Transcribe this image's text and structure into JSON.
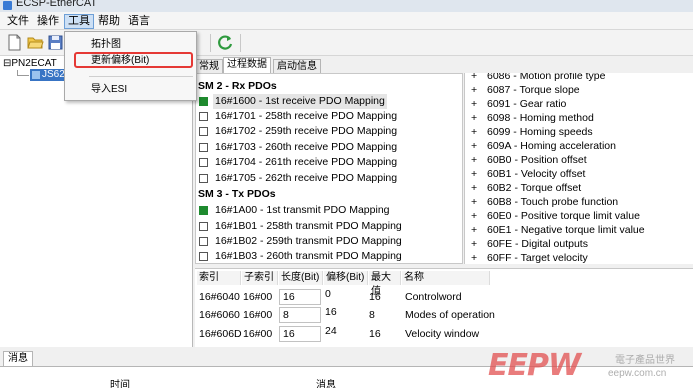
{
  "app": {
    "title": "ECSP-EtherCAT"
  },
  "menubar": {
    "items": [
      "文件",
      "操作",
      "工具",
      "帮助",
      "语言"
    ]
  },
  "tools_menu": {
    "items": [
      {
        "label": "拓扑图"
      },
      {
        "label": "更新偏移(Bit)",
        "highlighted": true
      },
      {
        "label": "导入ESI"
      }
    ]
  },
  "tree": {
    "root": "PN2ECAT",
    "child": "JS62"
  },
  "tabs": [
    "常规",
    "过程数据",
    "启动信息"
  ],
  "pdo": {
    "rx_section": "SM 2 - Rx PDOs",
    "rx": [
      {
        "text": "16#1600  -  1st receive PDO Mapping",
        "checked": true
      },
      {
        "text": "16#1701  -  258th receive PDO Mapping",
        "checked": false
      },
      {
        "text": "16#1702  -  259th receive PDO Mapping",
        "checked": false
      },
      {
        "text": "16#1703  -  260th receive PDO Mapping",
        "checked": false
      },
      {
        "text": "16#1704  -  261th receive PDO Mapping",
        "checked": false
      },
      {
        "text": "16#1705  -  262th receive PDO Mapping",
        "checked": false
      }
    ],
    "tx_section": "SM 3 - Tx PDOs",
    "tx": [
      {
        "text": "16#1A00  -  1st transmit PDO Mapping",
        "checked": true
      },
      {
        "text": "16#1B01  -  258th transmit PDO Mapping",
        "checked": false
      },
      {
        "text": "16#1B02  -  259th transmit PDO Mapping",
        "checked": false
      },
      {
        "text": "16#1B03  -  260th transmit PDO Mapping",
        "checked": false
      }
    ]
  },
  "objects": [
    "6086 - Motion profile type",
    "6087 - Torque slope",
    "6091 - Gear ratio",
    "6098 - Homing method",
    "6099 - Homing speeds",
    "609A - Homing acceleration",
    "60B0 - Position offset",
    "60B1 - Velocity offset",
    "60B2 - Torque offset",
    "60B8 - Touch probe function",
    "60E0 - Positive torque limit value",
    "60E1 - Negative torque limit value",
    "60FE - Digital outputs",
    "60FF - Target velocity"
  ],
  "entries": {
    "headers": [
      "索引",
      "子索引",
      "长度(Bit)",
      "偏移(Bit)",
      "最大值",
      "名称"
    ],
    "rows": [
      [
        "16#6040",
        "16#00",
        "16",
        "0",
        "16",
        "Controlword"
      ],
      [
        "16#6060",
        "16#00",
        "8",
        "16",
        "8",
        "Modes of operation"
      ],
      [
        "16#606D",
        "16#00",
        "16",
        "24",
        "16",
        "Velocity window"
      ]
    ]
  },
  "messages": {
    "tab": "消息",
    "col_time": "时间",
    "col_msg": "消息"
  },
  "watermark": {
    "logo": "EEPW",
    "cn": "電子產品世界",
    "url": "eepw.com.cn"
  },
  "colors": {
    "selection": "#3874c4",
    "checked": "#1e8a2e",
    "highlight_border": "#e53935"
  }
}
